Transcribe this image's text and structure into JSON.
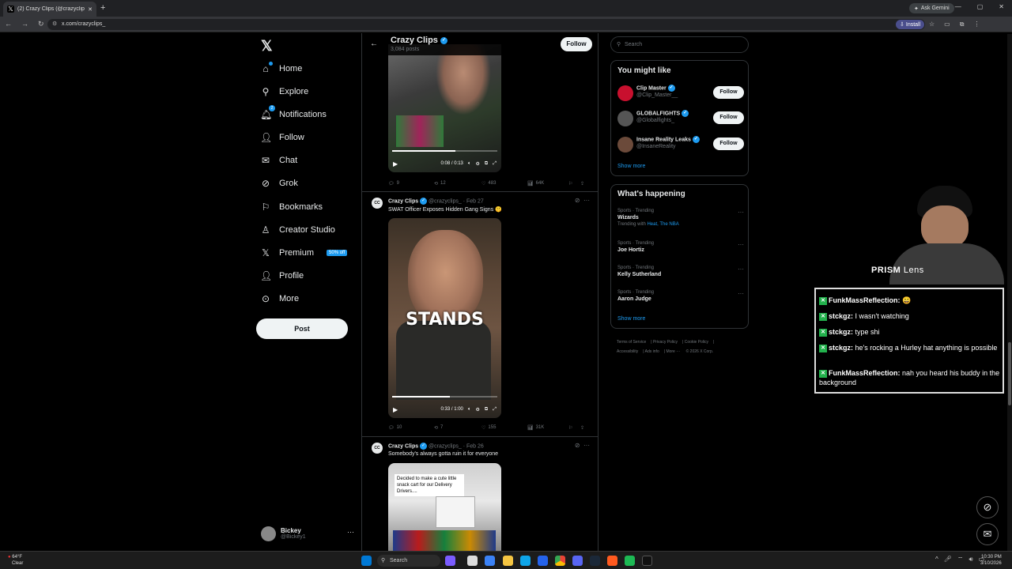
{
  "browser": {
    "tab_title": "(2) Crazy Clips (@crazyclips_) / X",
    "url": "x.com/crazyclips_",
    "ask_gemini": "Ask Gemini",
    "install": "Install"
  },
  "nav": {
    "items": [
      {
        "label": "Home",
        "icon": "home-icon"
      },
      {
        "label": "Explore",
        "icon": "search-icon"
      },
      {
        "label": "Notifications",
        "icon": "bell-icon",
        "badge": "2"
      },
      {
        "label": "Follow",
        "icon": "person-add-icon"
      },
      {
        "label": "Chat",
        "icon": "mail-icon"
      },
      {
        "label": "Grok",
        "icon": "grok-icon"
      },
      {
        "label": "Bookmarks",
        "icon": "bookmark-icon"
      },
      {
        "label": "Creator Studio",
        "icon": "creator-icon"
      },
      {
        "label": "Premium",
        "icon": "x-icon",
        "promo": "50% off"
      },
      {
        "label": "Profile",
        "icon": "person-icon"
      },
      {
        "label": "More",
        "icon": "more-circle-icon"
      }
    ],
    "post_button": "Post",
    "account": {
      "name": "Bickey",
      "handle": "@Bickey1"
    }
  },
  "profile_header": {
    "name": "Crazy Clips",
    "posts": "3,084 posts",
    "follow": "Follow"
  },
  "posts": [
    {
      "video_time": "0:08 / 0:13",
      "progress": 0.6,
      "replies": "9",
      "reposts": "12",
      "likes": "483",
      "views": "64K"
    },
    {
      "name": "Crazy Clips",
      "handle": "@crazyclips_",
      "date": "· Feb 27",
      "text": "SWAT Officer Exposes Hidden Gang Signs 🤫",
      "overlay_text": "STANDS",
      "video_time": "0:33 / 1:00",
      "progress": 0.55,
      "replies": "10",
      "reposts": "7",
      "likes": "155",
      "views": "31K"
    },
    {
      "name": "Crazy Clips",
      "handle": "@crazyclips_",
      "date": "· Feb 26",
      "text": "Somebody's always gotta ruin it for everyone",
      "image_caption": "Decided to make a cute little snack cart for our Delivery Drivers...."
    }
  ],
  "right": {
    "search_placeholder": "Search",
    "you_might_like": "You might like",
    "suggestions": [
      {
        "name": "Clip Master",
        "handle": "@Clip_Master__",
        "button": "Follow"
      },
      {
        "name": "GLOBALFIGHTS",
        "handle": "@Globalfights_",
        "button": "Follow"
      },
      {
        "name": "Insane Reality Leaks",
        "handle": "@InsaneReality",
        "button": "Follow"
      }
    ],
    "show_more": "Show more",
    "whats_happening": "What's happening",
    "trends": [
      {
        "category": "Sports · Trending",
        "name": "Wizards",
        "with_prefix": "Trending with",
        "with": "Heat, The NBA"
      },
      {
        "category": "Sports · Trending",
        "name": "Joe Hortiz"
      },
      {
        "category": "Sports · Trending",
        "name": "Kelly Sutherland"
      },
      {
        "category": "Sports · Trending",
        "name": "Aaron Judge"
      }
    ],
    "footer": [
      "Terms of Service",
      "Privacy Policy",
      "Cookie Policy",
      "Accessibility",
      "Ads info",
      "More ···",
      "© 2026 X Corp."
    ]
  },
  "overlay": {
    "prism_brand": "PRISM",
    "prism_lens": "Lens",
    "chat": [
      {
        "user": "FunkMassReflection:",
        "text": "😄"
      },
      {
        "user": "stckgz:",
        "text": "I wasn't watching"
      },
      {
        "user": "stckgz:",
        "text": "type shi"
      },
      {
        "user": "stckgz:",
        "text": "he's rocking a Hurley hat anything is possible"
      },
      {
        "user": "FunkMassReflection:",
        "text": "nah you heard his buddy in the background"
      }
    ]
  },
  "taskbar": {
    "temp": "64°F",
    "weather": "Clear",
    "search": "Search",
    "time": "10:30 PM",
    "date": "3/10/2026"
  },
  "colors": {
    "accent": "#1d9bf0",
    "bg": "#000000",
    "border": "#2f3336"
  }
}
